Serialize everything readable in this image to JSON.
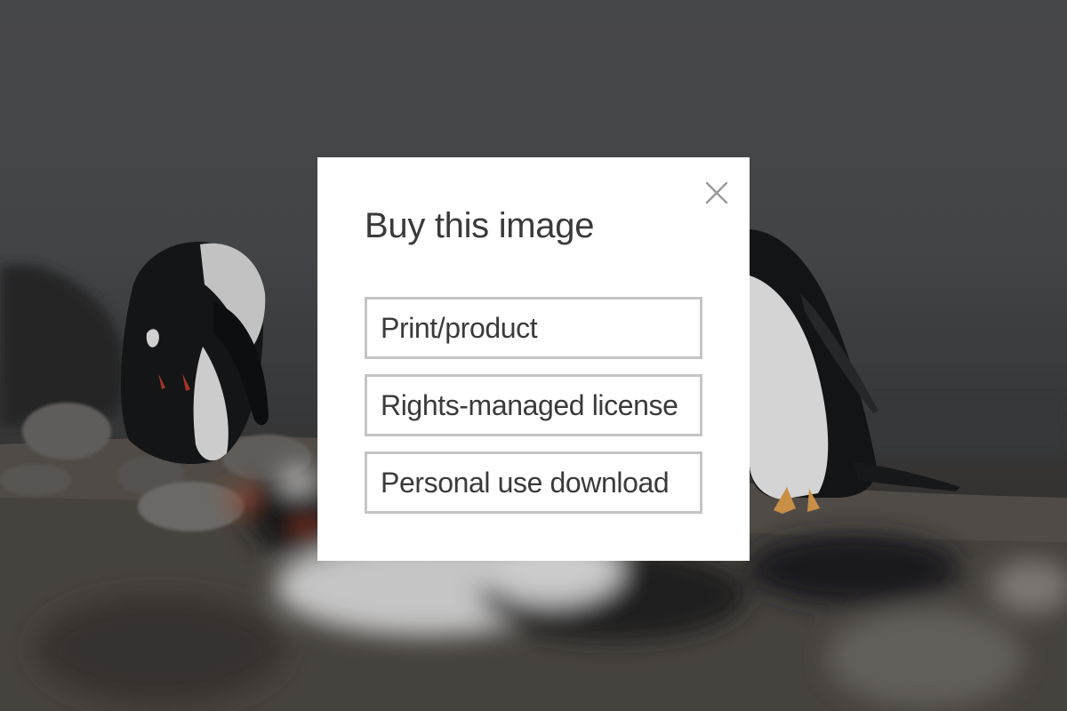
{
  "modal": {
    "title": "Buy this image",
    "close_icon": "close-icon",
    "options": [
      {
        "label": "Print/product"
      },
      {
        "label": "Rights-managed license"
      },
      {
        "label": "Personal use download"
      }
    ]
  },
  "colors": {
    "modal_background": "#ffffff",
    "text": "#3a3a3a",
    "button_border": "#c4c4c4",
    "close_icon": "#9a9a9a"
  }
}
